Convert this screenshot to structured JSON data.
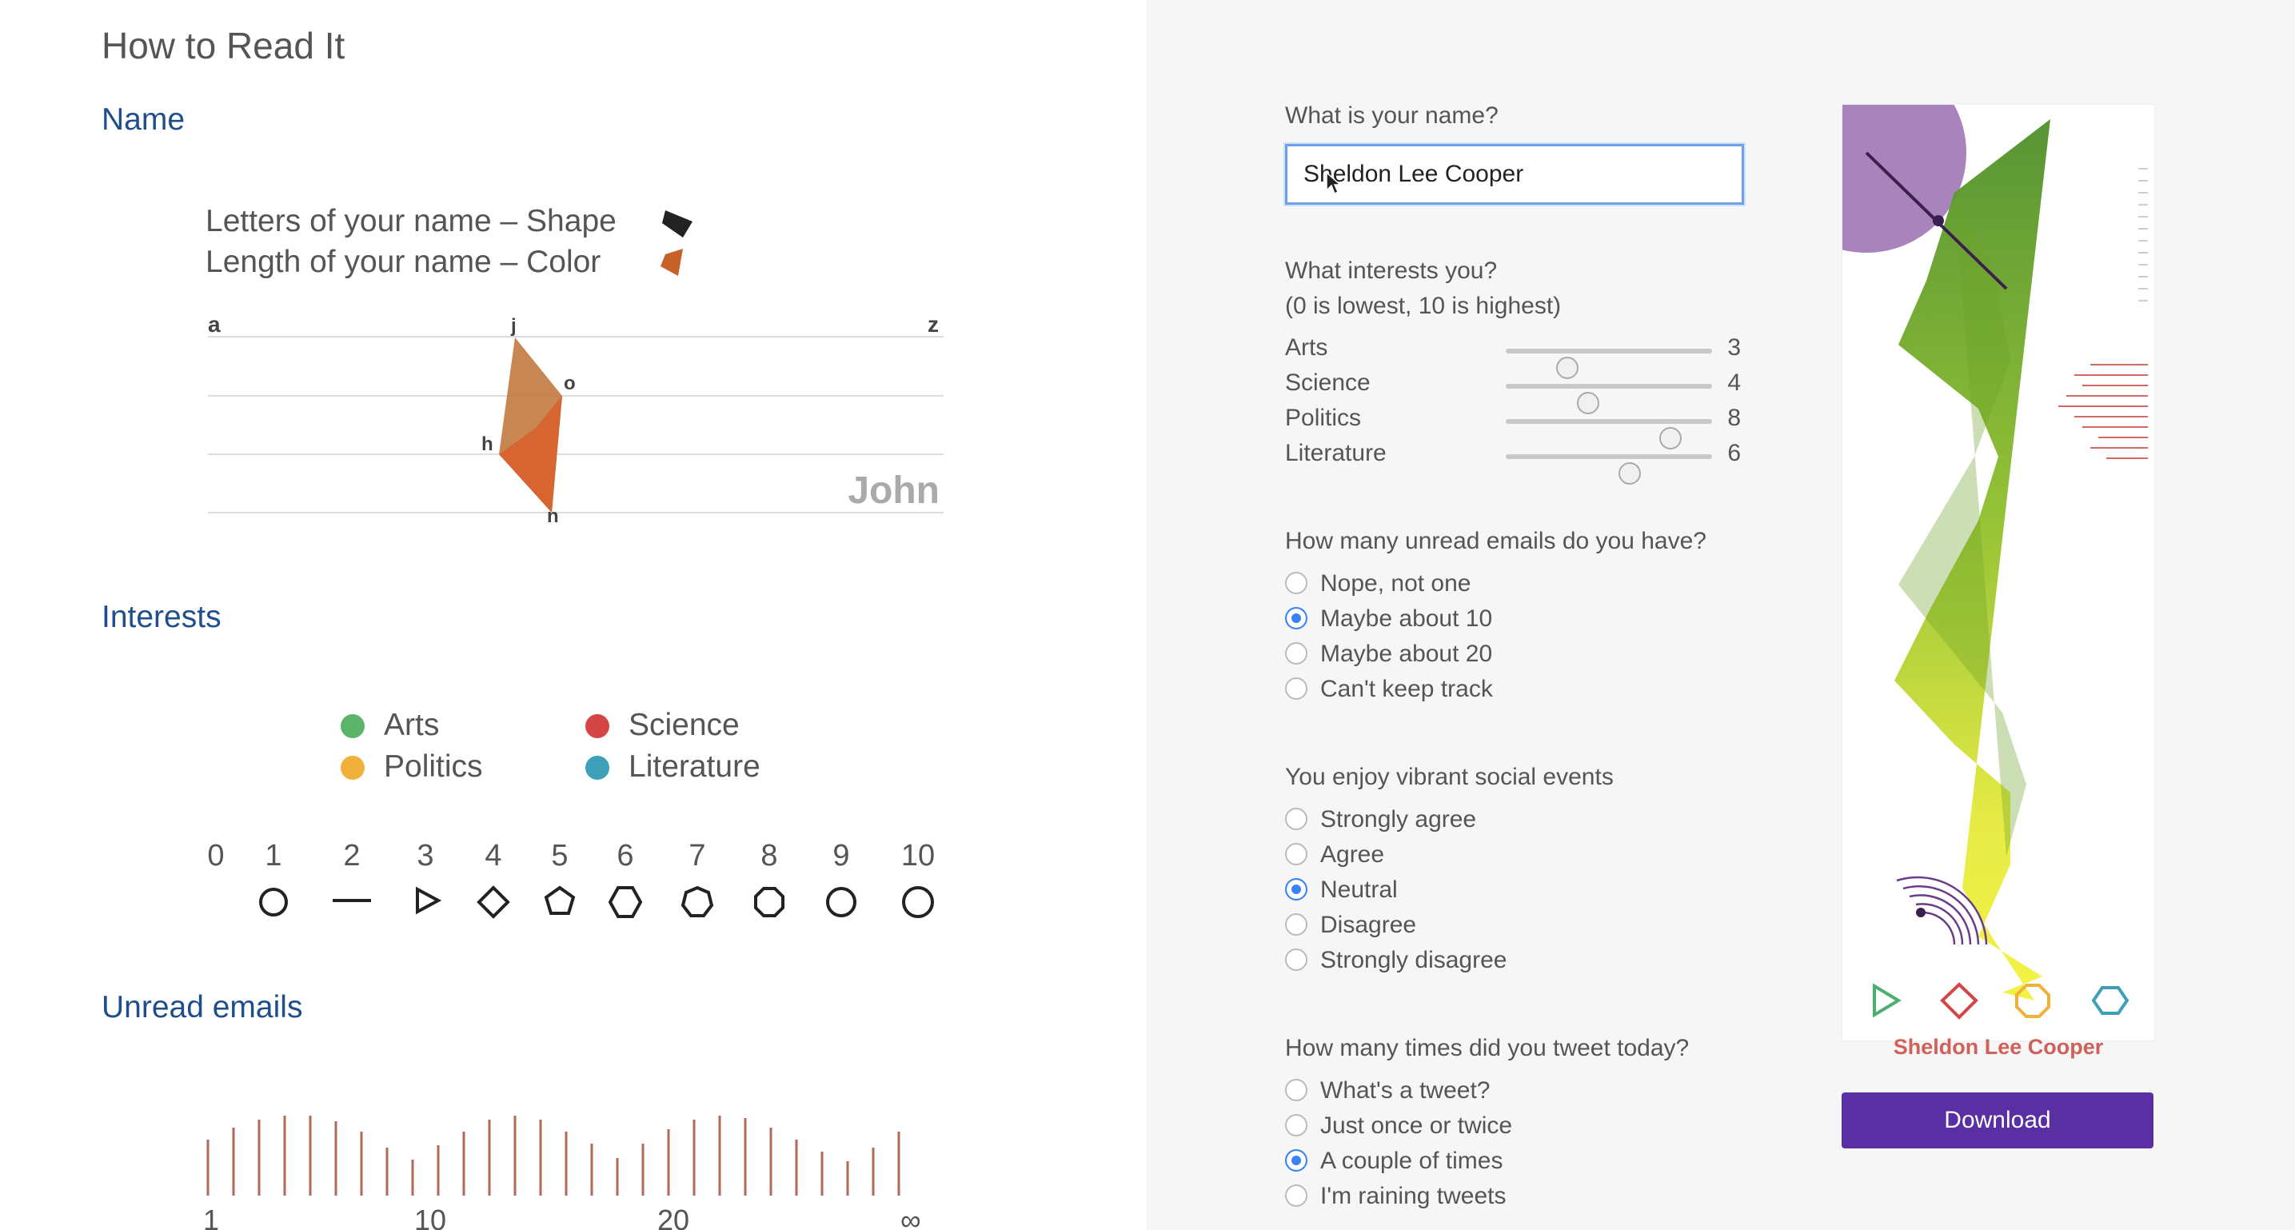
{
  "left": {
    "title": "How to Read It",
    "name_section": {
      "heading": "Name",
      "legend_shape": "Letters of your name – Shape",
      "legend_color": "Length of your name – Color",
      "axis_start": "a",
      "axis_end": "z",
      "sample_name": "John",
      "letters": [
        "j",
        "o",
        "h",
        "n"
      ]
    },
    "interests_section": {
      "heading": "Interests",
      "legend": [
        {
          "label": "Arts",
          "color": "#5cb46b"
        },
        {
          "label": "Science",
          "color": "#d64545"
        },
        {
          "label": "Politics",
          "color": "#f0b03a"
        },
        {
          "label": "Literature",
          "color": "#3e9fb8"
        }
      ],
      "scale": [
        "0",
        "1",
        "2",
        "3",
        "4",
        "5",
        "6",
        "7",
        "8",
        "9",
        "10"
      ],
      "scale_icons": [
        "none",
        "circle-icon",
        "line-icon",
        "triangle-icon",
        "diamond-icon",
        "pentagon-icon",
        "hexagon-icon",
        "heptagon-icon",
        "octagon-icon",
        "nonagon-icon",
        "decagon-icon"
      ]
    },
    "emails_section": {
      "heading": "Unread emails",
      "axis_labels": [
        "1",
        "10",
        "20",
        "∞"
      ]
    }
  },
  "form": {
    "name_question": "What is your name?",
    "name_value": "Sheldon Lee Cooper",
    "interests_question": "What interests you?",
    "interests_hint": "(0 is lowest, 10 is highest)",
    "sliders": [
      {
        "label": "Arts",
        "value": "3",
        "fraction": 0.3
      },
      {
        "label": "Science",
        "value": "4",
        "fraction": 0.4
      },
      {
        "label": "Politics",
        "value": "8",
        "fraction": 0.8
      },
      {
        "label": "Literature",
        "value": "6",
        "fraction": 0.6
      }
    ],
    "emails_question": "How many unread emails do you have?",
    "emails_options": [
      {
        "label": "Nope, not one",
        "checked": false
      },
      {
        "label": "Maybe about 10",
        "checked": true
      },
      {
        "label": "Maybe about 20",
        "checked": false
      },
      {
        "label": "Can't keep track",
        "checked": false
      }
    ],
    "social_question": "You enjoy vibrant social events",
    "social_options": [
      {
        "label": "Strongly agree",
        "checked": false
      },
      {
        "label": "Agree",
        "checked": false
      },
      {
        "label": "Neutral",
        "checked": true
      },
      {
        "label": "Disagree",
        "checked": false
      },
      {
        "label": "Strongly disagree",
        "checked": false
      }
    ],
    "tweet_question": "How many times did you tweet today?",
    "tweet_options": [
      {
        "label": "What's a tweet?",
        "checked": false
      },
      {
        "label": "Just once or twice",
        "checked": false
      },
      {
        "label": "A couple of times",
        "checked": true
      },
      {
        "label": "I'm raining tweets",
        "checked": false
      }
    ]
  },
  "preview": {
    "name": "Sheldon Lee Cooper",
    "icons": [
      "triangle-icon",
      "diamond-icon",
      "octagon-icon",
      "hexagon-icon"
    ],
    "icon_colors": [
      "#4caf6b",
      "#d64545",
      "#f0b03a",
      "#3e9fb8"
    ]
  },
  "download_label": "Download"
}
